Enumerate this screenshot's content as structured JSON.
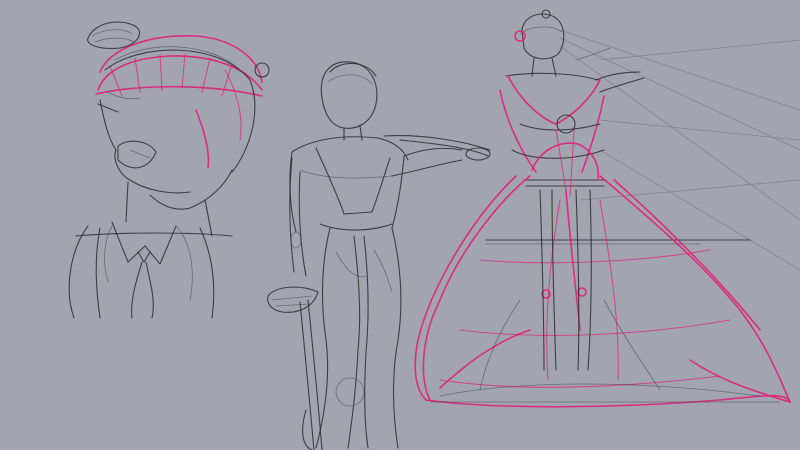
{
  "canvas": {
    "background": "#a2a5af",
    "ink_colors": {
      "graphite": "#2b2b2e",
      "magenta": "#e0207a"
    }
  },
  "sketches": [
    {
      "id": "portrait-bust",
      "subject": "character-head-and-shoulders"
    },
    {
      "id": "standing-figure",
      "subject": "character-standing-with-cane"
    },
    {
      "id": "gown-figure",
      "subject": "character-in-ball-gown"
    }
  ]
}
